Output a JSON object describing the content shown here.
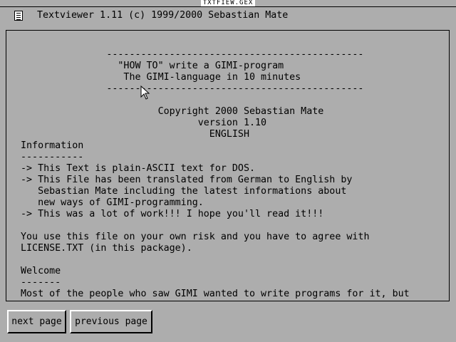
{
  "window": {
    "title": "TXTFIEW.GEX"
  },
  "header": {
    "icon": "document-icon",
    "title": "Textviewer 1.11 (c) 1999/2000 Sebastian Mate"
  },
  "content": {
    "lines": [
      "               ---------------------------------------------",
      "                 \"HOW TO\" write a GIMI-program",
      "                  The GIMI-language in 10 minutes",
      "               ---------------------------------------------",
      "",
      "                        Copyright 2000 Sebastian Mate",
      "                               version 1.10",
      "                                 ENGLISH",
      "Information",
      "-----------",
      "-> This Text is plain-ASCII text for DOS.",
      "-> This File has been translated from German to English by",
      "   Sebastian Mate including the latest informations about",
      "   new ways of GIMI-programming.",
      "-> This was a lot of work!!! I hope you'll read it!!!",
      "",
      "You use this file on your own risk and you have to agree with",
      "LICENSE.TXT (in this package).",
      "",
      "Welcome",
      "-------",
      "Most of the people who saw GIMI wanted to write programs for it, but"
    ]
  },
  "buttons": {
    "next": "next page",
    "previous": "previous page"
  },
  "colors": {
    "background": "#adadad",
    "text": "#000000",
    "highlight": "#ffffff"
  }
}
